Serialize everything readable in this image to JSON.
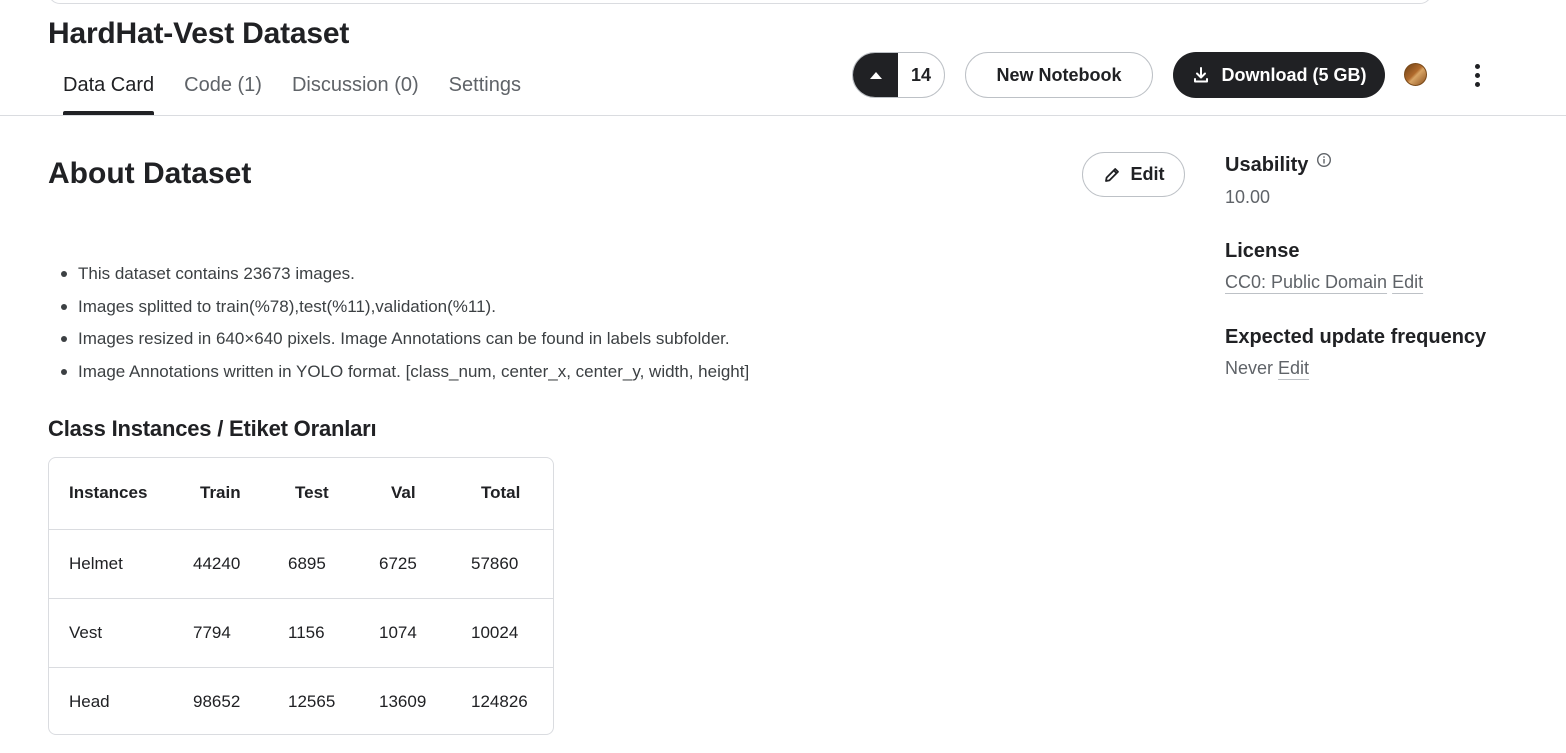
{
  "dataset": {
    "title": "HardHat-Vest Dataset"
  },
  "tabs": [
    {
      "label": "Data Card",
      "active": true
    },
    {
      "label": "Code (1)",
      "active": false
    },
    {
      "label": "Discussion (0)",
      "active": false
    },
    {
      "label": "Settings",
      "active": false
    }
  ],
  "actions": {
    "upvote_count": "14",
    "new_notebook_label": "New Notebook",
    "download_label": "Download (5 GB)",
    "upvote_icon": "caret-up-icon",
    "download_icon": "download-icon",
    "more_icon": "more-vert-icon"
  },
  "about": {
    "title": "About Dataset",
    "edit_label": "Edit",
    "bullets": [
      "This dataset contains 23673 images.",
      "Images splitted to train(%78),test(%11),validation(%11).",
      "Images resized in 640×640 pixels. Image Annotations can be found in labels subfolder.",
      "Image Annotations written in YOLO format. [class_num, center_x, center_y, width, height]"
    ]
  },
  "class_table": {
    "heading": "Class Instances / Etiket Oranları",
    "columns": [
      "Instances",
      "Train",
      "Test",
      "Val",
      "Total"
    ],
    "rows": [
      [
        "Helmet",
        "44240",
        "6895",
        "6725",
        "57860"
      ],
      [
        "Vest",
        "7794",
        "1156",
        "1074",
        "10024"
      ],
      [
        "Head",
        "98652",
        "12565",
        "13609",
        "124826"
      ]
    ]
  },
  "sidebar": {
    "usability_label": "Usability",
    "usability_value": "10.00",
    "license_label": "License",
    "license_value": "CC0: Public Domain",
    "license_edit": "Edit",
    "frequency_label": "Expected update frequency",
    "frequency_value": "Never",
    "frequency_edit": "Edit"
  },
  "colors": {
    "primary_dark": "#202124",
    "border": "#dadce0",
    "muted_text": "#5f6368"
  }
}
